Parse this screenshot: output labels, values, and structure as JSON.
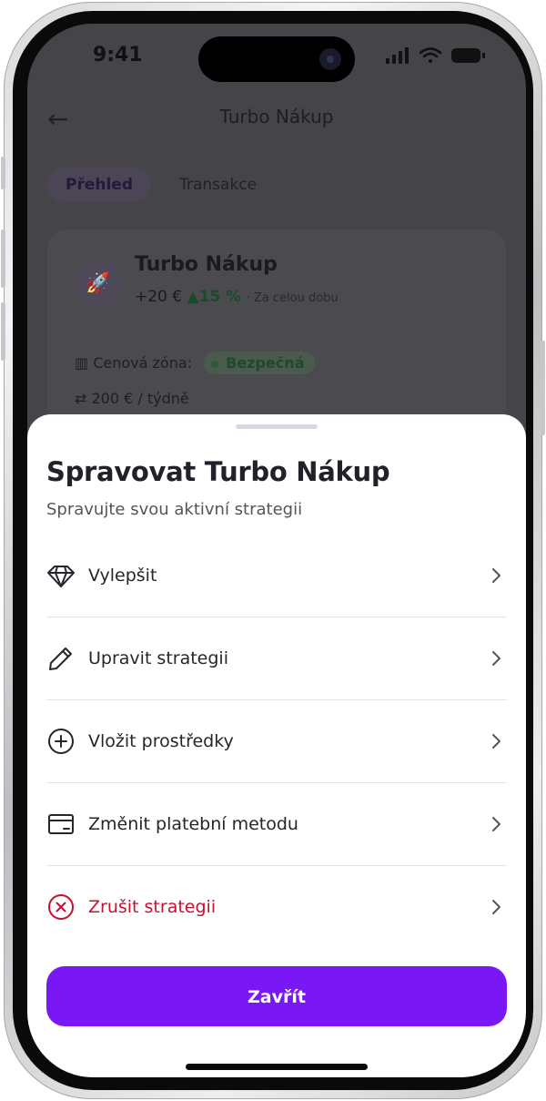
{
  "status_bar": {
    "time": "9:41"
  },
  "background": {
    "header_title": "Turbo Nákup",
    "tabs": [
      "Přehled",
      "Transakce"
    ],
    "card": {
      "title": "Turbo Nákup",
      "amount": "+20 €",
      "change": "15 %",
      "period": "Za celou dobu",
      "zone_label": "Cenová zóna:",
      "zone_value": "Bezpečná",
      "frequency": "200 € / týdně"
    }
  },
  "sheet": {
    "title": "Spravovat Turbo Nákup",
    "subtitle": "Spravujte svou aktivní strategii",
    "items": [
      {
        "label": "Vylepšit",
        "icon": "diamond-icon"
      },
      {
        "label": "Upravit strategii",
        "icon": "pencil-icon"
      },
      {
        "label": "Vložit prostředky",
        "icon": "plus-circle-icon"
      },
      {
        "label": "Změnit platební metodu",
        "icon": "card-icon"
      },
      {
        "label": "Zrušit strategii",
        "icon": "x-circle-icon",
        "danger": true
      }
    ],
    "close_label": "Zavřít"
  },
  "colors": {
    "accent": "#7a18f5",
    "danger": "#c8102e",
    "text": "#26252c",
    "divider": "#e4e2ea"
  }
}
